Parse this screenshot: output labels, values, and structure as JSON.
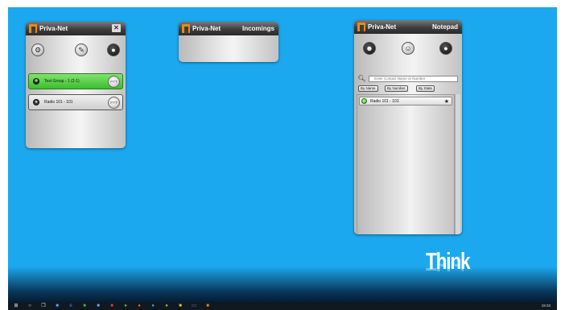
{
  "desktop": {
    "brand_text": "Think"
  },
  "windows": {
    "main": {
      "app_title": "Priva-Net",
      "rows": [
        {
          "label": "Test Group - 1 (2-1)",
          "ptt": "PTT",
          "state": "active"
        },
        {
          "label": "Radio 101 - 101",
          "ptt": "PTT",
          "state": "idle"
        }
      ],
      "icons": [
        "settings-icon",
        "edit-icon",
        "speaker-icon"
      ]
    },
    "incomings": {
      "app_title": "Priva-Net",
      "sub_title": "Incomings"
    },
    "notepad": {
      "app_title": "Priva-Net",
      "sub_title": "Notepad",
      "search_placeholder": "Enter Contact Name or Number",
      "filters": [
        "By Name",
        "By Number",
        "By State"
      ],
      "contacts": [
        {
          "label": "Radio 101 - 101",
          "favorite_glyph": "★"
        }
      ],
      "icons": [
        "contact-icon",
        "group-icon",
        "speaker-icon"
      ]
    }
  },
  "taskbar": {
    "items": [
      "start-icon",
      "search-icon",
      "task-view-icon",
      "store-icon",
      "edge-icon",
      "explorer-icon",
      "app-icon",
      "app-icon",
      "app-icon",
      "app-icon",
      "app-icon",
      "app-icon",
      "app-icon",
      "app-icon",
      "app-icon"
    ],
    "clock": "19:33"
  },
  "colors": {
    "desktop": "#1ba8ef",
    "active_row": "#3bbf2c",
    "logo": "#e88a1a"
  }
}
